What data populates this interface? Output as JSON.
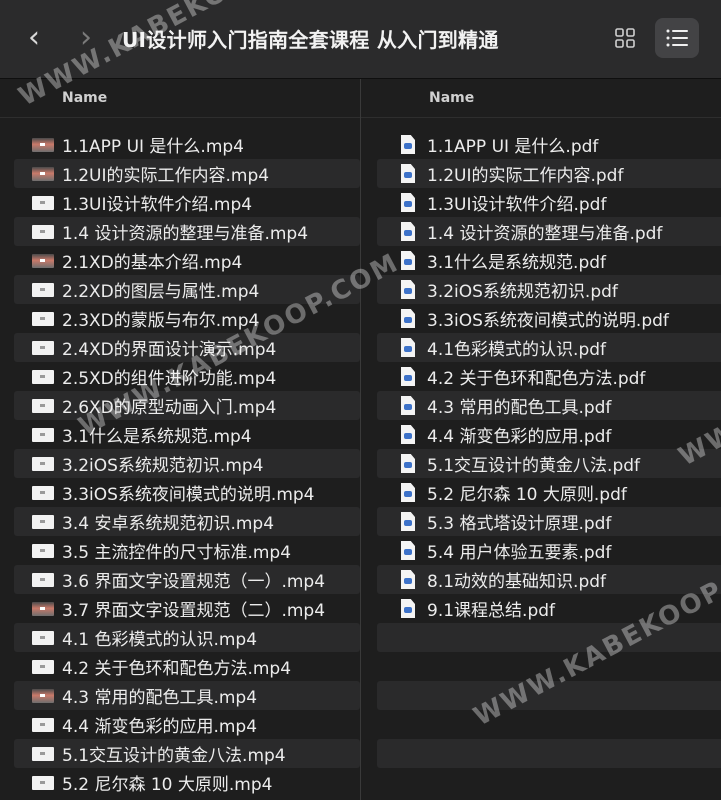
{
  "window": {
    "title": "UI设计师入门指南全套课程  从入门到精通",
    "back_glyph": "‹",
    "forward_glyph": "›",
    "view_grid_icon": "grid-view-icon",
    "view_list_icon": "list-view-icon"
  },
  "left_pane": {
    "column_header": "Name",
    "files": [
      {
        "name": "1.1APP UI 是什么.mp4",
        "icon": "video-thumbnail-icon"
      },
      {
        "name": "1.2UI的实际工作内容.mp4",
        "icon": "video-thumbnail-icon"
      },
      {
        "name": "1.3UI设计软件介绍.mp4",
        "icon": "video-file-icon"
      },
      {
        "name": "1.4 设计资源的整理与准备.mp4",
        "icon": "video-file-icon"
      },
      {
        "name": "2.1XD的基本介绍.mp4",
        "icon": "video-thumbnail-icon"
      },
      {
        "name": "2.2XD的图层与属性.mp4",
        "icon": "video-file-icon"
      },
      {
        "name": "2.3XD的蒙版与布尔.mp4",
        "icon": "video-file-icon"
      },
      {
        "name": "2.4XD的界面设计演示.mp4",
        "icon": "video-file-icon"
      },
      {
        "name": "2.5XD的组件进阶功能.mp4",
        "icon": "video-file-icon"
      },
      {
        "name": "2.6XD的原型动画入门.mp4",
        "icon": "video-file-icon"
      },
      {
        "name": "3.1什么是系统规范.mp4",
        "icon": "video-file-icon"
      },
      {
        "name": "3.2iOS系统规范初识.mp4",
        "icon": "video-file-icon"
      },
      {
        "name": "3.3iOS系统夜间模式的说明.mp4",
        "icon": "video-file-icon"
      },
      {
        "name": "3.4 安卓系统规范初识.mp4",
        "icon": "video-file-icon"
      },
      {
        "name": "3.5 主流控件的尺寸标准.mp4",
        "icon": "video-file-icon"
      },
      {
        "name": "3.6 界面文字设置规范（一）.mp4",
        "icon": "video-file-icon"
      },
      {
        "name": "3.7 界面文字设置规范（二）.mp4",
        "icon": "video-thumbnail-icon"
      },
      {
        "name": "4.1 色彩模式的认识.mp4",
        "icon": "video-file-icon"
      },
      {
        "name": "4.2 关于色环和配色方法.mp4",
        "icon": "video-file-icon"
      },
      {
        "name": "4.3 常用的配色工具.mp4",
        "icon": "video-thumbnail-icon"
      },
      {
        "name": "4.4 渐变色彩的应用.mp4",
        "icon": "video-file-icon"
      },
      {
        "name": "5.1交互设计的黄金八法.mp4",
        "icon": "video-file-icon"
      },
      {
        "name": "5.2 尼尔森 10 大原则.mp4",
        "icon": "video-file-icon"
      }
    ]
  },
  "right_pane": {
    "column_header": "Name",
    "files": [
      {
        "name": "1.1APP UI 是什么.pdf",
        "icon": "pdf-file-icon"
      },
      {
        "name": "1.2UI的实际工作内容.pdf",
        "icon": "pdf-file-icon"
      },
      {
        "name": "1.3UI设计软件介绍.pdf",
        "icon": "pdf-file-icon"
      },
      {
        "name": "1.4 设计资源的整理与准备.pdf",
        "icon": "pdf-file-icon"
      },
      {
        "name": "3.1什么是系统规范.pdf",
        "icon": "pdf-file-icon"
      },
      {
        "name": "3.2iOS系统规范初识.pdf",
        "icon": "pdf-file-icon"
      },
      {
        "name": "3.3iOS系统夜间模式的说明.pdf",
        "icon": "pdf-file-icon"
      },
      {
        "name": "4.1色彩模式的认识.pdf",
        "icon": "pdf-file-icon"
      },
      {
        "name": "4.2 关于色环和配色方法.pdf",
        "icon": "pdf-file-icon"
      },
      {
        "name": "4.3 常用的配色工具.pdf",
        "icon": "pdf-file-icon"
      },
      {
        "name": "4.4 渐变色彩的应用.pdf",
        "icon": "pdf-file-icon"
      },
      {
        "name": "5.1交互设计的黄金八法.pdf",
        "icon": "pdf-file-icon"
      },
      {
        "name": "5.2 尼尔森 10 大原则.pdf",
        "icon": "pdf-file-icon"
      },
      {
        "name": "5.3 格式塔设计原理.pdf",
        "icon": "pdf-file-icon"
      },
      {
        "name": "5.4 用户体验五要素.pdf",
        "icon": "pdf-file-icon"
      },
      {
        "name": "8.1动效的基础知识.pdf",
        "icon": "pdf-file-icon"
      },
      {
        "name": "9.1课程总结.pdf",
        "icon": "pdf-file-icon"
      }
    ]
  },
  "watermarks": [
    "WWW.KABEKOOP.COM",
    "WWW.KABEKOOP.COM",
    "WWW.KABEKOOP.COM",
    "WWW.KABEKOOP.COM"
  ],
  "colors": {
    "background": "#1e1e1e",
    "toolbar": "#2b2b2c",
    "row_alt": "#2a2a2b",
    "pdf_accent": "#3d72c9"
  }
}
